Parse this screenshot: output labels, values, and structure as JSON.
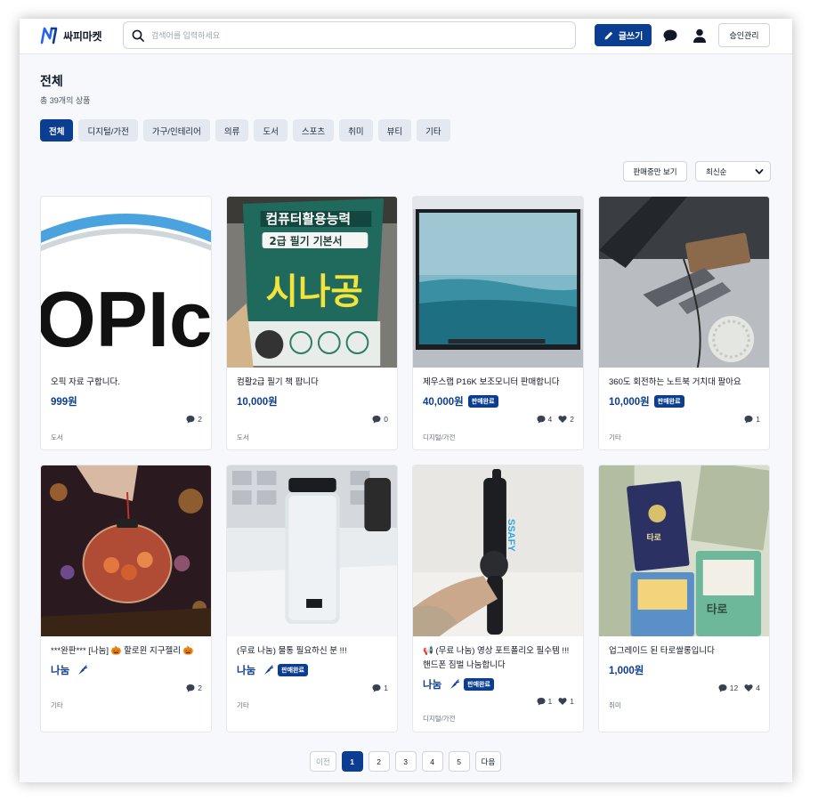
{
  "header": {
    "logo_text": "싸피마켓",
    "search_placeholder": "검색어를 입력하세요",
    "write_label": "글쓰기",
    "admin_label": "승인관리"
  },
  "main": {
    "title": "전체",
    "count": "총 39개의 상품",
    "categories": [
      {
        "label": "전체",
        "active": true
      },
      {
        "label": "디지털/가전",
        "active": false
      },
      {
        "label": "가구/인테리어",
        "active": false
      },
      {
        "label": "의류",
        "active": false
      },
      {
        "label": "도서",
        "active": false
      },
      {
        "label": "스포츠",
        "active": false
      },
      {
        "label": "취미",
        "active": false
      },
      {
        "label": "뷰티",
        "active": false
      },
      {
        "label": "기타",
        "active": false
      }
    ],
    "filter_label": "판매중만 보기",
    "sort_selected": "최신순"
  },
  "products": [
    {
      "title": "오픽 자료 구합니다.",
      "price": "999원",
      "badge": "",
      "comments": "2",
      "likes": "",
      "category": "도서"
    },
    {
      "title": "컴활2급 필기 책 팝니다",
      "price": "10,000원",
      "badge": "",
      "comments": "0",
      "likes": "",
      "category": "도서"
    },
    {
      "title": "제우스랩 P16K 보조모니터 판매합니다",
      "price": "40,000원",
      "badge": "판매완료",
      "comments": "4",
      "likes": "2",
      "category": "디지털/가전"
    },
    {
      "title": "360도 회전하는 노트북 거치대 팔아요",
      "price": "10,000원",
      "badge": "판매완료",
      "comments": "1",
      "likes": "",
      "category": "기타"
    },
    {
      "title": "***완판*** [나눔] 🎃 할로윈 지구젤리 🎃",
      "price": "나눔",
      "badge": "",
      "comments": "2",
      "likes": "",
      "category": "기타"
    },
    {
      "title": "(무료 나눔) 물통 필요하신 분 !!!",
      "price": "나눔",
      "badge": "판매완료",
      "comments": "1",
      "likes": "",
      "category": "기타"
    },
    {
      "title": "📢 (무료 나눔) 영상 포트폴리오 필수템 !!! 핸드폰 짐벌 나눔합니다",
      "price": "나눔",
      "badge": "판매완료",
      "comments": "1",
      "likes": "1",
      "category": "디지털/가전"
    },
    {
      "title": "업그레이드 된 타로쌀롱입니다",
      "price": "1,000원",
      "badge": "",
      "comments": "12",
      "likes": "4",
      "category": "취미"
    }
  ],
  "pagination": {
    "prev_label": "이전",
    "pages": [
      "1",
      "2",
      "3",
      "4",
      "5"
    ],
    "current": "1",
    "next_label": "다음"
  },
  "colors": {
    "accent": "#0b3d91",
    "background": "#f6f8fb"
  },
  "icons": {
    "logo": "logo-n-icon",
    "search": "search-icon",
    "write": "pencil-icon",
    "chat": "chat-bubble-icon",
    "user": "user-icon",
    "sort": "chevron-down-icon",
    "comments": "comment-icon",
    "likes": "heart-icon",
    "share": "carrot-icon"
  }
}
